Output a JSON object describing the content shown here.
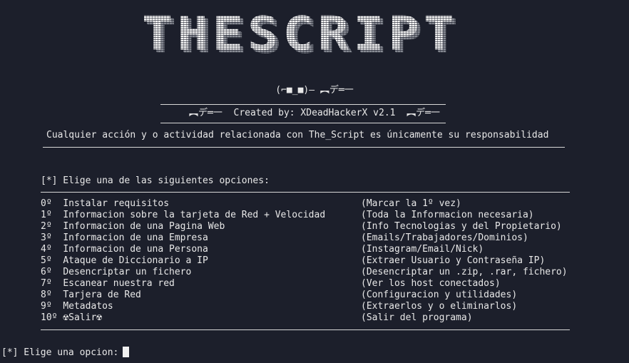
{
  "banner": {
    "title": "THESCRIPT",
    "face": "(⌐■_■)– ︻デ═一"
  },
  "credits": {
    "gun_left": "︻デ═一",
    "text": "Created by: XDeadHackerX v2.1",
    "gun_right": "︻デ═一"
  },
  "disclaimer": "Cualquier acción y o actividad relacionada con The_Script es únicamente su responsabilidad",
  "menu": {
    "prompt": "[*] Elige una de las siguientes opciones:",
    "options": [
      {
        "num": "0º",
        "label": "Instalar requisitos",
        "desc": "(Marcar la 1º vez)"
      },
      {
        "num": "1º",
        "label": "Informacion sobre la tarjeta de Red + Velocidad",
        "desc": "(Toda la Informacion necesaria)"
      },
      {
        "num": "2º",
        "label": "Informacion de una Pagina Web",
        "desc": "(Info Tecnologias y del Propietario)"
      },
      {
        "num": "3º",
        "label": "Informacion de una Empresa",
        "desc": "(Emails/Trabajadores/Dominios)"
      },
      {
        "num": "4º",
        "label": "Informacion de una Persona",
        "desc": "(Instagram/Email/Nick)"
      },
      {
        "num": "5º",
        "label": "Ataque de Diccionario a IP",
        "desc": "(Extraer Usuario y Contraseña IP)"
      },
      {
        "num": "6º",
        "label": "Desencriptar un fichero",
        "desc": "(Desencriptar un .zip, .rar, fichero)"
      },
      {
        "num": "7º",
        "label": "Escanear nuestra red",
        "desc": "(Ver los host conectados)"
      },
      {
        "num": "8º",
        "label": "Tarjera de Red",
        "desc": "(Configuracion y utilidades)"
      },
      {
        "num": "9º",
        "label": "Metadatos",
        "desc": "(Extraerlos y o eliminarlos)"
      },
      {
        "num": "10º",
        "label": "☢Salir☢",
        "desc": "(Salir del programa)"
      }
    ]
  },
  "input": {
    "prompt": "[*] Elige una opcion:"
  }
}
